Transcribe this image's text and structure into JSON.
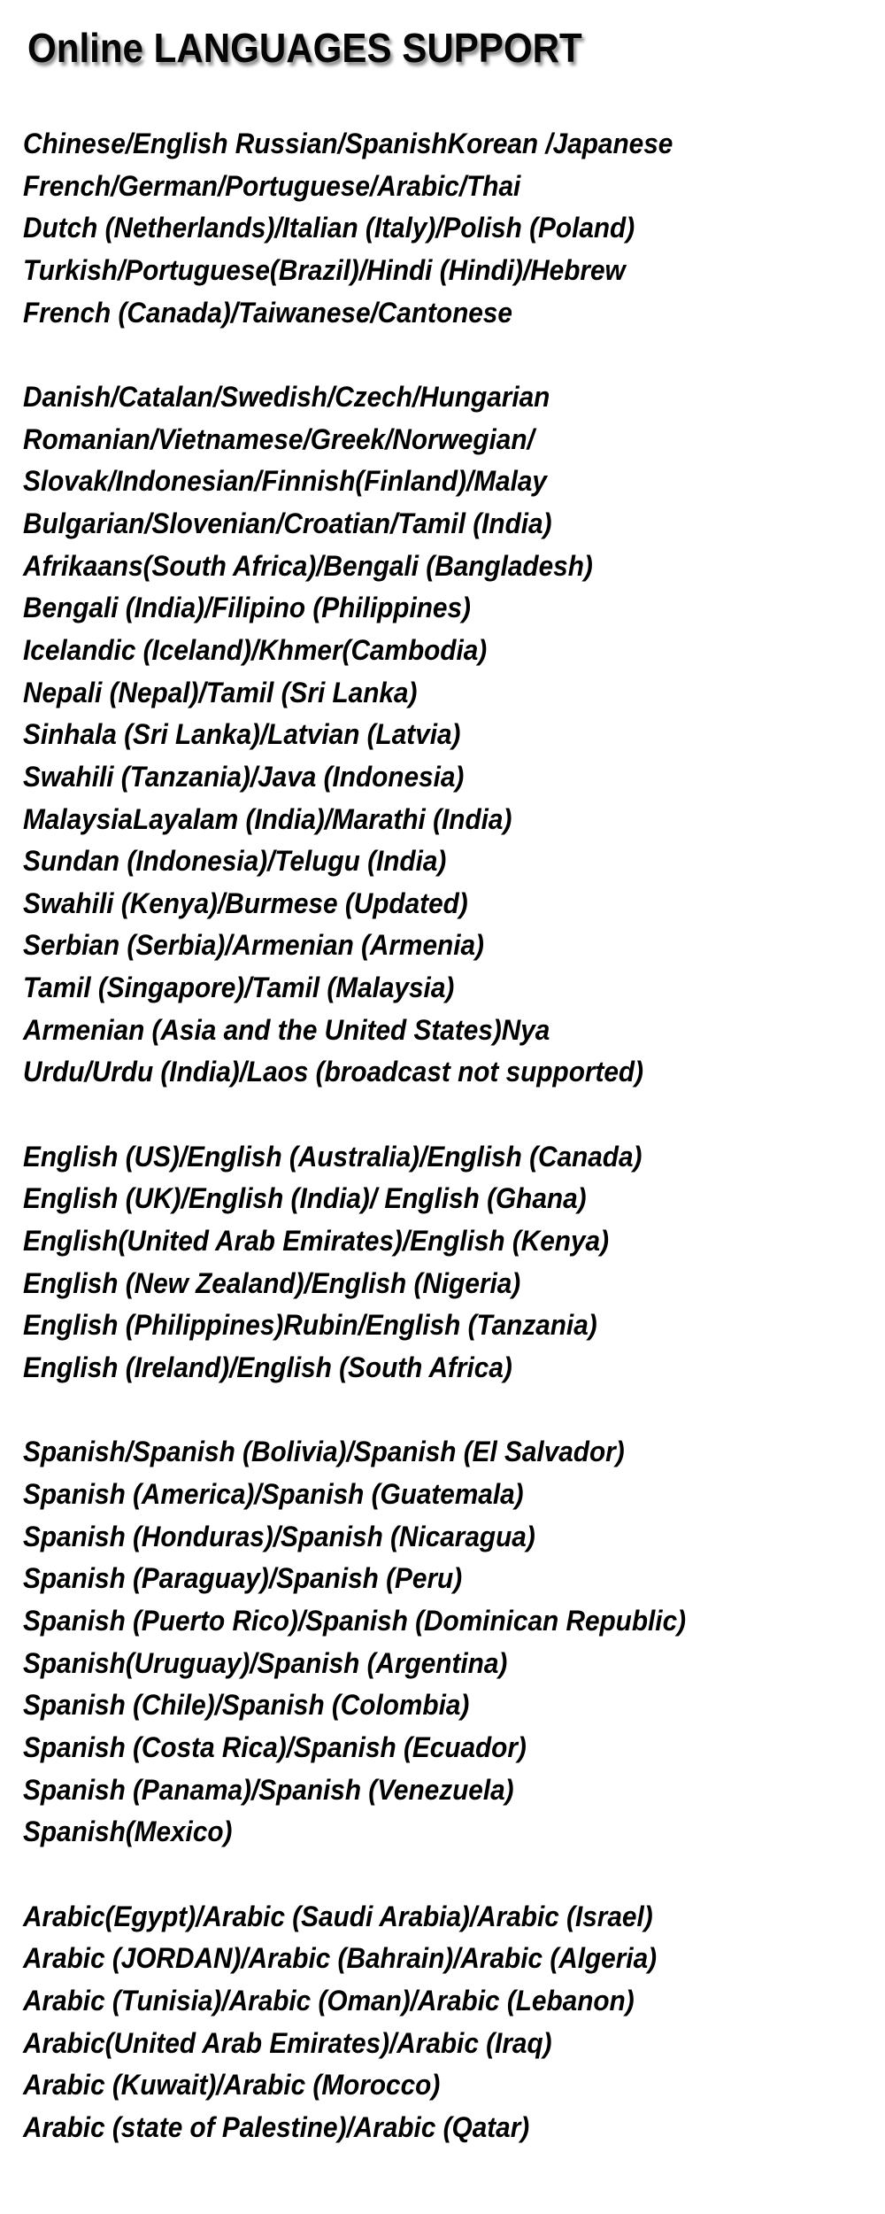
{
  "title": "Online LANGUAGES SUPPORT",
  "sections": [
    {
      "name": "major-languages",
      "lines": [
        "Chinese/English Russian/SpanishKorean /Japanese",
        "French/German/Portuguese/Arabic/Thai",
        "Dutch (Netherlands)/Italian (Italy)/Polish (Poland)",
        "Turkish/Portuguese(Brazil)/Hindi (Hindi)/Hebrew",
        "French (Canada)/Taiwanese/Cantonese"
      ]
    },
    {
      "name": "other-languages",
      "lines": [
        "Danish/Catalan/Swedish/Czech/Hungarian",
        "Romanian/Vietnamese/Greek/Norwegian/",
        "Slovak/Indonesian/Finnish(Finland)/Malay",
        "Bulgarian/Slovenian/Croatian/Tamil (India)",
        "Afrikaans(South Africa)/Bengali (Bangladesh)",
        "Bengali (India)/Filipino (Philippines)",
        "Icelandic (Iceland)/Khmer(Cambodia)",
        "Nepali (Nepal)/Tamil (Sri Lanka)",
        "Sinhala (Sri Lanka)/Latvian (Latvia)",
        "Swahili (Tanzania)/Java (Indonesia)",
        "MalaysiaLayalam (India)/Marathi (India)",
        "Sundan (Indonesia)/Telugu (India)",
        "Swahili (Kenya)/Burmese (Updated)",
        "Serbian (Serbia)/Armenian (Armenia)",
        "Tamil (Singapore)/Tamil (Malaysia)",
        "Armenian (Asia and the United States)Nya",
        "Urdu/Urdu (India)/Laos (broadcast not supported)"
      ]
    },
    {
      "name": "english-variants",
      "lines": [
        "English (US)/English (Australia)/English (Canada)",
        "English (UK)/English (India)/ English (Ghana)",
        "English(United Arab Emirates)/English (Kenya)",
        "English (New Zealand)/English (Nigeria)",
        "English (Philippines)Rubin/English (Tanzania)",
        "English (Ireland)/English (South Africa)"
      ]
    },
    {
      "name": "spanish-variants",
      "lines": [
        "Spanish/Spanish (Bolivia)/Spanish (El Salvador)",
        "Spanish (America)/Spanish (Guatemala)",
        "Spanish (Honduras)/Spanish (Nicaragua)",
        "Spanish (Paraguay)/Spanish (Peru)",
        "Spanish (Puerto Rico)/Spanish (Dominican Republic)",
        "Spanish(Uruguay)/Spanish (Argentina)",
        "Spanish (Chile)/Spanish (Colombia)",
        "Spanish (Costa Rica)/Spanish (Ecuador)",
        "Spanish (Panama)/Spanish (Venezuela)",
        "Spanish(Mexico)"
      ]
    },
    {
      "name": "arabic-variants",
      "lines": [
        "Arabic(Egypt)/Arabic (Saudi Arabia)/Arabic (Israel)",
        "Arabic (JORDAN)/Arabic (Bahrain)/Arabic (Algeria)",
        "Arabic (Tunisia)/Arabic (Oman)/Arabic (Lebanon)",
        "Arabic(United Arab Emirates)/Arabic (Iraq)",
        "Arabic (Kuwait)/Arabic (Morocco)",
        "Arabic (state of Palestine)/Arabic (Qatar)"
      ]
    }
  ]
}
